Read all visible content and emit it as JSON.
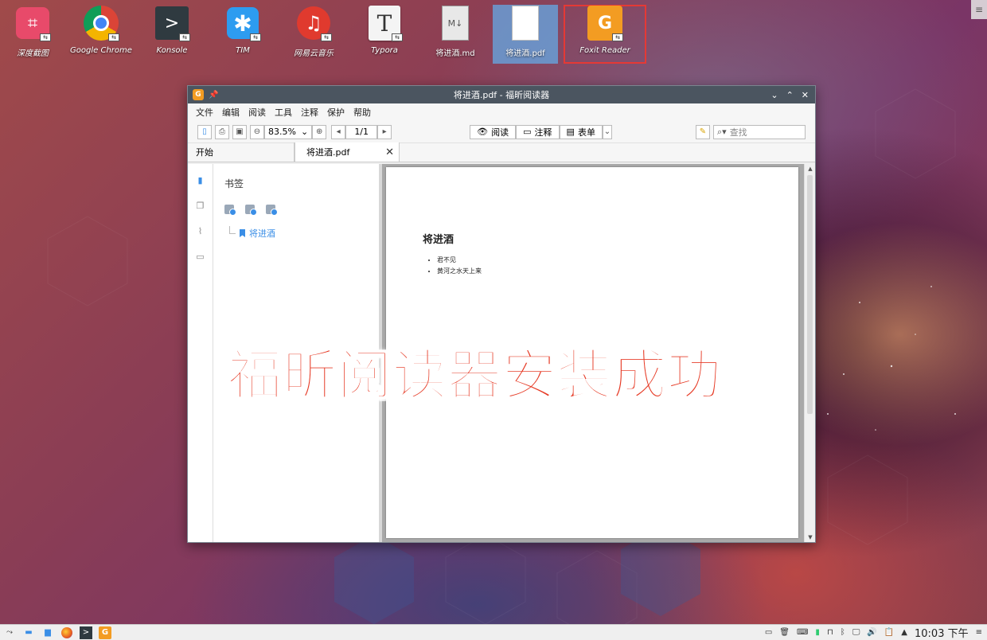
{
  "desktop": {
    "icons": [
      {
        "label": "深度截图"
      },
      {
        "label": "Google Chrome"
      },
      {
        "label": "Konsole"
      },
      {
        "label": "TIM"
      },
      {
        "label": "网易云音乐"
      },
      {
        "label": "Typora"
      },
      {
        "label": "将进酒.md"
      },
      {
        "label": "将进酒.pdf"
      },
      {
        "label": "Foxit Reader"
      }
    ],
    "corner_menu_glyph": "≡"
  },
  "window": {
    "title": "将进酒.pdf - 福昕阅读器",
    "app_glyph": "G",
    "pin_glyph": "📌",
    "controls": {
      "minimize": "⌄",
      "maximize": "⌃",
      "close": "✕"
    },
    "menu": [
      "文件",
      "编辑",
      "阅读",
      "工具",
      "注释",
      "保护",
      "帮助"
    ],
    "toolbar": {
      "zoom": "83.5%",
      "page": "1/1",
      "mode_read": "阅读",
      "mode_comment": "注释",
      "mode_form": "表单",
      "search_placeholder": "查找"
    },
    "tabs": {
      "start": "开始",
      "doc": "将进酒.pdf",
      "close_glyph": "✕"
    },
    "bookmarks": {
      "title": "书签",
      "item": "将进酒"
    },
    "document": {
      "heading": "将进酒",
      "bullets": [
        "君不见",
        "黄河之水天上来"
      ]
    }
  },
  "overlay_caption": "福昕阅读器安装成功",
  "taskbar": {
    "clock": "10:03 下午"
  },
  "colors": {
    "accent": "#3a8ee6",
    "titlebar": "#4b5560",
    "caption_red": "#e63a25",
    "highlight_box": "#e53935",
    "foxit_orange": "#f39c22"
  }
}
